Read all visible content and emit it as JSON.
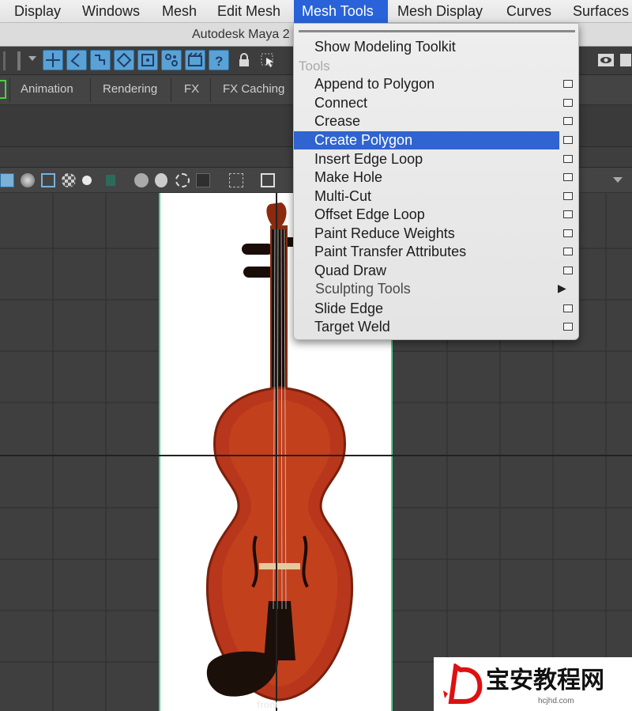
{
  "menubar": {
    "items": [
      "Display",
      "Windows",
      "Mesh",
      "Edit Mesh",
      "Mesh Tools",
      "Mesh Display",
      "Curves",
      "Surfaces"
    ],
    "active_index": 4,
    "active_color": "#2962d9"
  },
  "titlebar": {
    "title": "Autodesk Maya 2"
  },
  "shelf": {
    "tabs": [
      "Animation",
      "Rendering",
      "FX",
      "FX Caching"
    ]
  },
  "dropdown": {
    "header_item": "Show Modeling Toolkit",
    "section_label": "Tools",
    "items": [
      {
        "label": "Append to Polygon",
        "kind": "option"
      },
      {
        "label": "Connect",
        "kind": "option"
      },
      {
        "label": "Crease",
        "kind": "option"
      },
      {
        "label": "Create Polygon",
        "kind": "option",
        "highlighted": true
      },
      {
        "label": "Insert Edge Loop",
        "kind": "option"
      },
      {
        "label": "Make Hole",
        "kind": "option"
      },
      {
        "label": "Multi-Cut",
        "kind": "option"
      },
      {
        "label": "Offset Edge Loop",
        "kind": "option"
      },
      {
        "label": "Paint Reduce Weights",
        "kind": "option"
      },
      {
        "label": "Paint Transfer Attributes",
        "kind": "option"
      },
      {
        "label": "Quad Draw",
        "kind": "option"
      },
      {
        "label": "Sculpting Tools",
        "kind": "submenu"
      },
      {
        "label": "Slide Edge",
        "kind": "option"
      },
      {
        "label": "Target Weld",
        "kind": "option"
      }
    ],
    "highlight_color": "#2f64d1"
  },
  "viewport": {
    "camera_label": "front",
    "image_plane_border_color": "#4fd18d"
  },
  "icons": {
    "toolbar": [
      "move-tool-icon",
      "lasso-icon",
      "paint-select-icon",
      "component-icon",
      "snap-icon",
      "history-icon",
      "render-icon",
      "help-icon",
      "lock-icon",
      "select-cursor-icon",
      "eye-icon"
    ]
  },
  "watermark": {
    "text": "宝安教程网",
    "url": "hcjhd.com"
  }
}
